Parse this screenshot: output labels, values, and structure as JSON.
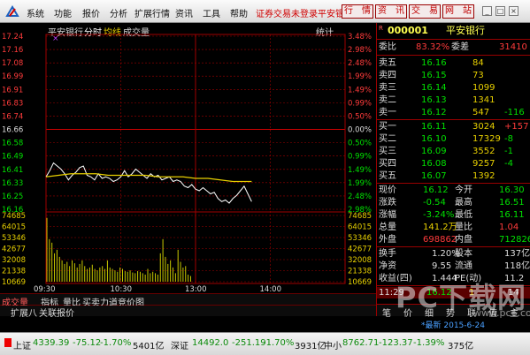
{
  "menubar": {
    "items": [
      "系统",
      "功能",
      "报价",
      "分析",
      "扩展行情",
      "资讯",
      "工具",
      "帮助"
    ],
    "status_link": "证券交易未登录",
    "stock_link": "平安银",
    "tabs": [
      "行　情",
      "资　讯",
      "交　易",
      "网　站"
    ],
    "window_buttons": [
      "_",
      "□",
      "×"
    ]
  },
  "chart_header": {
    "stock_name": "平安银行",
    "mode": "分时",
    "avg_label": "均线",
    "vol_label": "成交量",
    "stats_label": "统计",
    "marker": "×"
  },
  "chart_data": {
    "type": "line",
    "price_axis_left": [
      "17.24",
      "17.16",
      "17.08",
      "16.99",
      "16.91",
      "16.83",
      "16.74",
      "16.66",
      "16.58",
      "16.49",
      "16.41",
      "16.33",
      "16.25",
      "16.16"
    ],
    "price_axis_right": [
      "3.48%",
      "2.98%",
      "2.48%",
      "1.99%",
      "1.49%",
      "0.99%",
      "0.50%",
      "0.00%",
      "0.50%",
      "0.99%",
      "1.49%",
      "1.99%",
      "2.48%",
      "2.98%"
    ],
    "volume_axis": [
      "74685",
      "64015",
      "53346",
      "42677",
      "32008",
      "21338",
      "10669"
    ],
    "x_ticks": [
      "09:30",
      "10:30",
      "13:00",
      "14:00"
    ],
    "ylim": [
      16.12,
      17.24
    ],
    "prev_close": 16.66,
    "series": [
      {
        "name": "分时",
        "color": "#ffffff",
        "x": [
          0,
          3,
          6,
          9,
          12,
          15,
          18,
          21,
          24,
          27,
          30,
          33,
          36,
          39,
          42,
          45,
          48,
          51,
          54,
          57,
          60,
          63,
          66,
          69,
          72,
          75,
          78,
          81,
          84,
          87,
          90,
          93,
          96,
          99,
          102,
          105,
          108,
          111,
          114,
          117,
          120,
          123,
          126,
          129,
          132,
          135,
          138,
          141,
          144,
          147,
          150,
          153,
          156,
          159,
          162,
          165
        ],
        "values": [
          16.33,
          16.37,
          16.42,
          16.4,
          16.38,
          16.35,
          16.31,
          16.34,
          16.36,
          16.39,
          16.4,
          16.34,
          16.33,
          16.31,
          16.35,
          16.32,
          16.33,
          16.32,
          16.3,
          16.31,
          16.33,
          16.37,
          16.33,
          16.35,
          16.38,
          16.36,
          16.34,
          16.32,
          16.35,
          16.33,
          16.34,
          16.31,
          16.32,
          16.33,
          16.3,
          16.31,
          16.3,
          16.27,
          16.26,
          16.28,
          16.25,
          16.24,
          16.26,
          16.24,
          16.22,
          16.23,
          16.19,
          16.17,
          16.18,
          16.16,
          16.19,
          16.21,
          16.24,
          16.27,
          16.22,
          16.17
        ]
      },
      {
        "name": "均线",
        "color": "#e8d000",
        "x": [
          0,
          10,
          20,
          30,
          40,
          50,
          60,
          70,
          80,
          90,
          100,
          110,
          120,
          130,
          140,
          150,
          160,
          165
        ],
        "values": [
          16.33,
          16.34,
          16.35,
          16.35,
          16.35,
          16.34,
          16.34,
          16.34,
          16.34,
          16.33,
          16.33,
          16.33,
          16.32,
          16.32,
          16.31,
          16.3,
          16.3,
          16.3
        ]
      }
    ],
    "x_total": 240,
    "volume": [
      90,
      60,
      55,
      40,
      45,
      35,
      30,
      25,
      28,
      22,
      30,
      26,
      20,
      25,
      30,
      22,
      18,
      20,
      24,
      18,
      16,
      20,
      22,
      18,
      30,
      20,
      18,
      16,
      14,
      20,
      18,
      15,
      14,
      16,
      13,
      12,
      15,
      14,
      12,
      10,
      18,
      12,
      14,
      12,
      10,
      40,
      60,
      35,
      25,
      30,
      20,
      12,
      45,
      28,
      20,
      22,
      10,
      8
    ]
  },
  "bottom_tabs": [
    "成交量",
    "指标",
    "量比",
    "买卖力道",
    "竞价图"
  ],
  "bottom_tabs2": [
    "扩展八",
    "关联报价"
  ],
  "panel": {
    "code": "000001",
    "name": "平安银行",
    "r_label": "R",
    "weibi": {
      "label": "委比",
      "value": "83.32%",
      "diff_label": "委差",
      "diff": "31410"
    },
    "asks": [
      {
        "label": "卖五",
        "price": "16.16",
        "vol": "84",
        "chg": ""
      },
      {
        "label": "卖四",
        "price": "16.15",
        "vol": "73",
        "chg": ""
      },
      {
        "label": "卖三",
        "price": "16.14",
        "vol": "1099",
        "chg": ""
      },
      {
        "label": "卖二",
        "price": "16.13",
        "vol": "1341",
        "chg": ""
      },
      {
        "label": "卖一",
        "price": "16.12",
        "vol": "547",
        "chg": "-116"
      }
    ],
    "bids": [
      {
        "label": "买一",
        "price": "16.11",
        "vol": "3024",
        "chg": "+157"
      },
      {
        "label": "买二",
        "price": "16.10",
        "vol": "17329",
        "chg": "-8"
      },
      {
        "label": "买三",
        "price": "16.09",
        "vol": "3552",
        "chg": "-1"
      },
      {
        "label": "买四",
        "price": "16.08",
        "vol": "9257",
        "chg": "-4"
      },
      {
        "label": "买五",
        "price": "16.07",
        "vol": "1392",
        "chg": ""
      }
    ],
    "stats": [
      {
        "l1": "现价",
        "v1": "16.12",
        "c1": "#00e000",
        "l2": "今开",
        "v2": "16.30",
        "c2": "#00e000"
      },
      {
        "l1": "涨跌",
        "v1": "-0.54",
        "c1": "#00e000",
        "l2": "最高",
        "v2": "16.51",
        "c2": "#00e000"
      },
      {
        "l1": "涨幅",
        "v1": "-3.24%",
        "c1": "#00e000",
        "l2": "最低",
        "v2": "16.11",
        "c2": "#00e000"
      },
      {
        "l1": "总量",
        "v1": "141.2万",
        "c1": "#e8d000",
        "l2": "量比",
        "v2": "1.04",
        "c2": "#ff3b3b"
      },
      {
        "l1": "外盘",
        "v1": "698862",
        "c1": "#ff3b3b",
        "l2": "内盘",
        "v2": "712826",
        "c2": "#00e000"
      }
    ],
    "stats2": [
      {
        "l1": "换手",
        "v1": "1.20%",
        "l2": "股本",
        "v2": "137亿"
      },
      {
        "l1": "净资",
        "v1": "9.55",
        "l2": "流通",
        "v2": "118亿"
      },
      {
        "l1": "收益(四)",
        "v1": "1.444",
        "l2": "PE(动)",
        "v2": "11.2"
      }
    ],
    "tick": {
      "time": "11:29",
      "price": "16.12",
      "vol": "1",
      "num": "14"
    },
    "small_tabs": [
      "笔",
      "价",
      "细",
      "势",
      "联",
      "值",
      "主"
    ]
  },
  "statusbar": {
    "sh_label": "上证",
    "sh_val": "4339.39",
    "sh_chg": "-75.12",
    "sh_pct": "-1.70%",
    "sh_amt": "5401亿",
    "sz_label": "深证",
    "sz_val": "14492.0",
    "sz_chg": "-251.19",
    "sz_pct": "-1.70%",
    "sz_amt": "3931亿",
    "zx_label": "中小",
    "zx_val": "8762.71",
    "zx_chg": "-123.37",
    "zx_pct": "-1.39%",
    "zx_amt": "375亿"
  },
  "update_time": "*最新 2015-6-24",
  "watermark": "PC下载网",
  "watermark_url": "www.pc6.com",
  "colors": {
    "up": "#ff3b3b",
    "down": "#00e000",
    "grid": "#a00000",
    "avg": "#e8d000",
    "volume": "#c8c800"
  }
}
